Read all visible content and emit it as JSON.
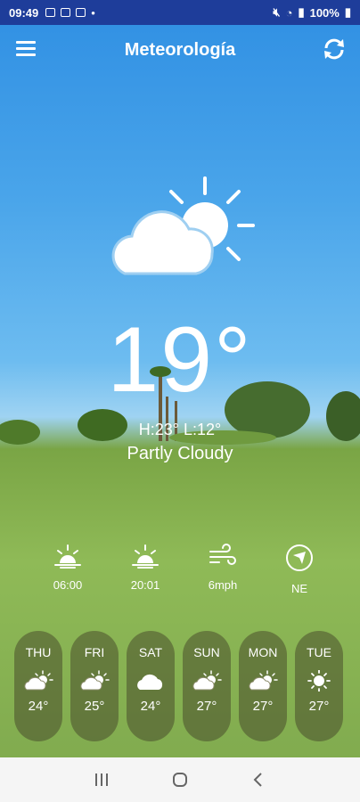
{
  "status_bar": {
    "time": "09:49",
    "battery": "100%"
  },
  "app": {
    "title": "Meteorología"
  },
  "current": {
    "temperature": "19°",
    "high_low": "H:23° L:12°",
    "condition": "Partly Cloudy"
  },
  "details": [
    {
      "icon": "sunrise-icon",
      "label": "06:00"
    },
    {
      "icon": "sunset-icon",
      "label": "20:01"
    },
    {
      "icon": "wind-icon",
      "label": "6mph"
    },
    {
      "icon": "compass-icon",
      "label": "NE"
    }
  ],
  "forecast": [
    {
      "day": "THU",
      "icon": "partly-cloudy-icon",
      "temp": "24°"
    },
    {
      "day": "FRI",
      "icon": "partly-cloudy-icon",
      "temp": "25°"
    },
    {
      "day": "SAT",
      "icon": "cloud-icon",
      "temp": "24°"
    },
    {
      "day": "SUN",
      "icon": "partly-cloudy-icon",
      "temp": "27°"
    },
    {
      "day": "MON",
      "icon": "partly-cloudy-icon",
      "temp": "27°"
    },
    {
      "day": "TUE",
      "icon": "sun-icon",
      "temp": "27°"
    }
  ],
  "colors": {
    "status_bar": "#1e3d9a",
    "sky": "#4aa5ea",
    "grass": "#8fba57"
  }
}
